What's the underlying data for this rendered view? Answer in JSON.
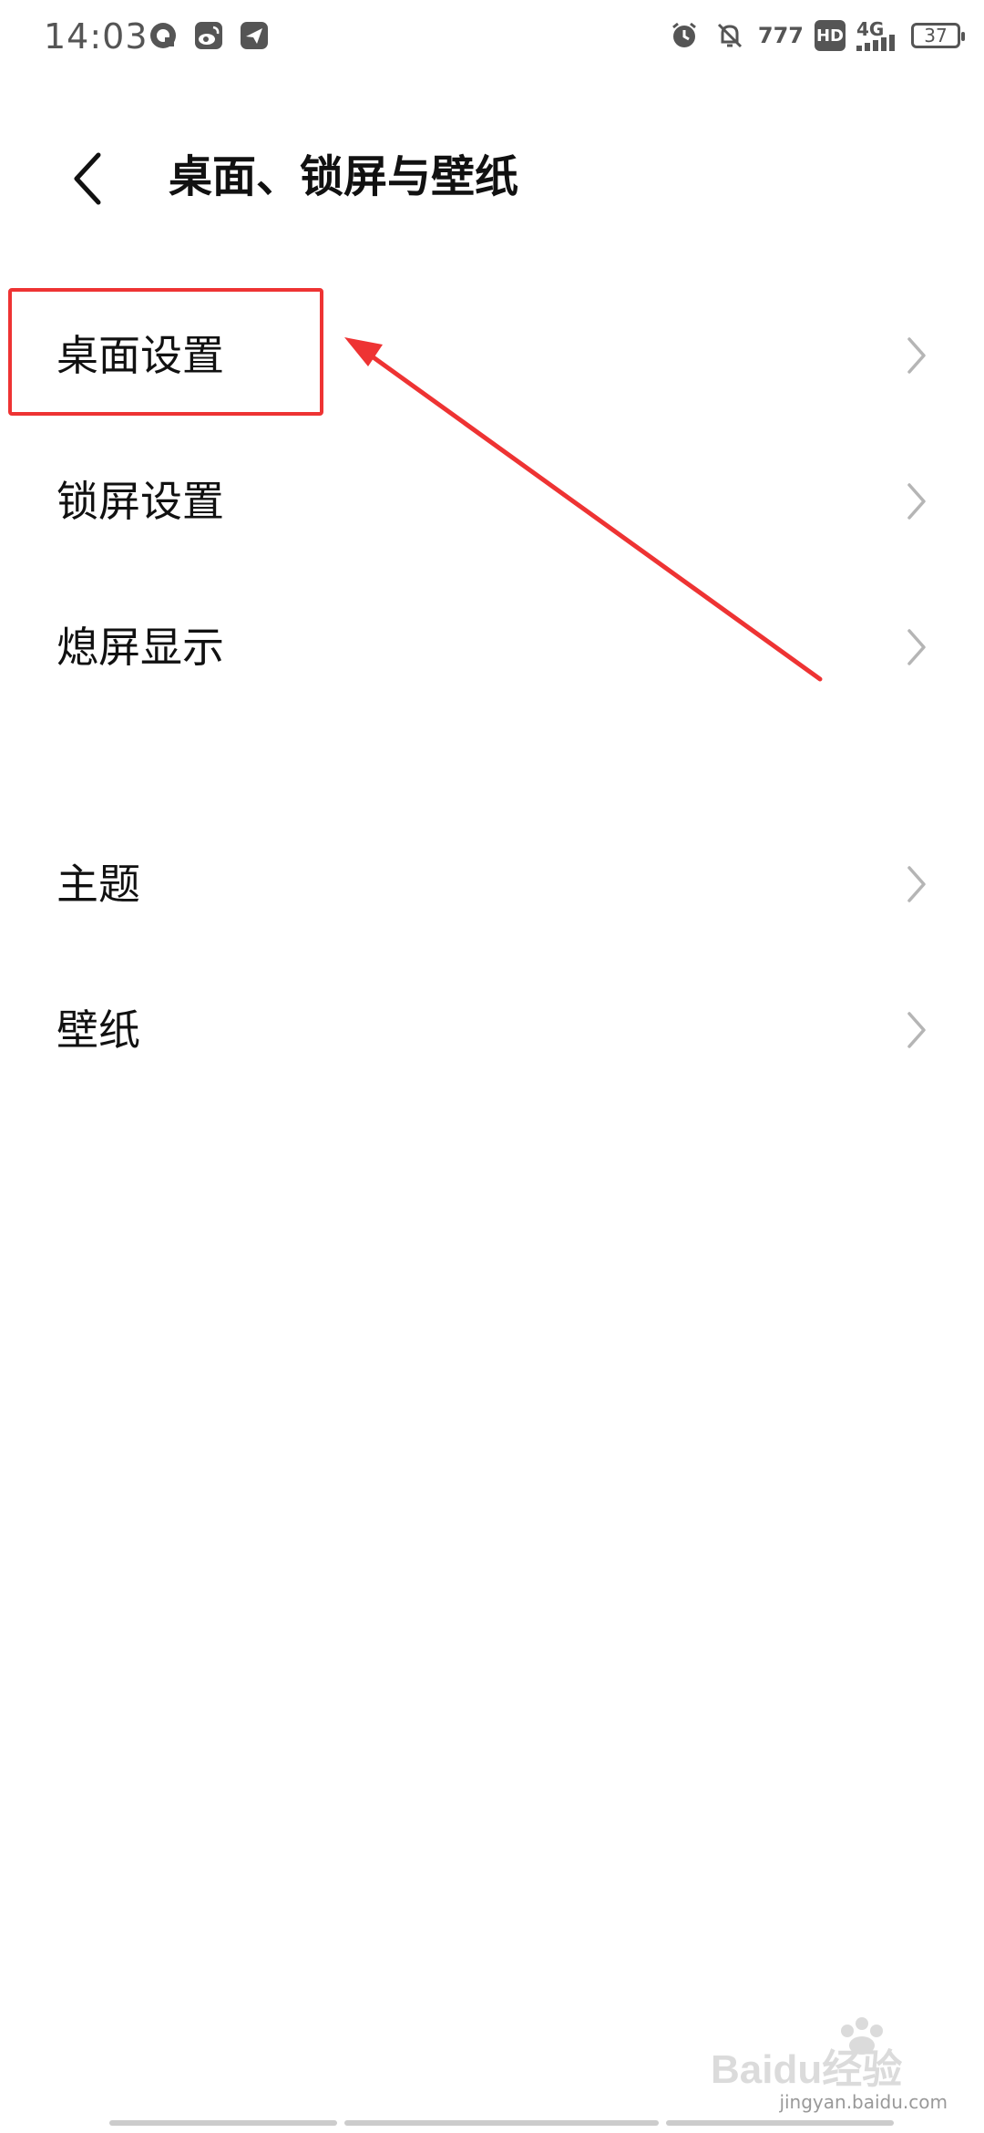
{
  "status_bar": {
    "time": "14:03",
    "left_icons": [
      "chat-bubble-icon",
      "weibo-icon",
      "send-icon"
    ],
    "right_icons": [
      "alarm-icon",
      "mute-bell-icon",
      "network-label",
      "hd-badge",
      "signal-4g-icon",
      "battery-icon"
    ],
    "network_label": "777",
    "hd_label": "HD",
    "signal_label": "4G",
    "battery_level": "37"
  },
  "header": {
    "back_icon": "chevron-left-icon",
    "title": "桌面、锁屏与壁纸"
  },
  "groups": [
    {
      "items": [
        {
          "label": "桌面设置"
        },
        {
          "label": "锁屏设置"
        },
        {
          "label": "熄屏显示"
        }
      ]
    },
    {
      "items": [
        {
          "label": "主题"
        },
        {
          "label": "壁纸"
        }
      ]
    }
  ],
  "annotation": {
    "color": "#ee3333",
    "highlighted_item": "桌面设置"
  },
  "watermark": {
    "text": "Baidu经验",
    "subtext": "jingyan.baidu.com"
  }
}
